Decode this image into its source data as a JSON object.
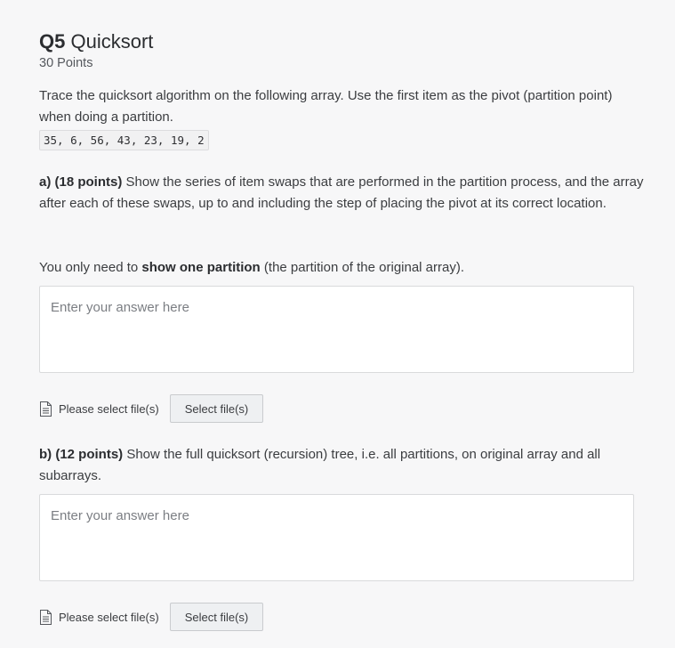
{
  "question": {
    "number": "Q5",
    "title": "Quicksort",
    "points": "30 Points",
    "intro": "Trace the quicksort algorithm on the following array. Use the first item as the pivot (partition point) when doing a partition.",
    "array": "35, 6, 56, 43, 23, 19, 2"
  },
  "part_a": {
    "label": "a) (18 points)",
    "text": " Show the series of item swaps that are performed in the partition process, and the array after each of these swaps, up to and including the step of placing the pivot at its correct location.",
    "note_prefix": "You only need to ",
    "note_bold": "show one partition",
    "note_suffix": " (the partition of the original array).",
    "answer_placeholder": "Enter your answer here",
    "file_label": "Please select file(s)",
    "file_button": "Select file(s)"
  },
  "part_b": {
    "label": "b) (12 points)",
    "text": " Show the full quicksort (recursion) tree, i.e. all partitions, on original array and all subarrays.",
    "answer_placeholder": "Enter your answer here",
    "file_label": "Please select file(s)",
    "file_button": "Select file(s)"
  },
  "icons": {
    "file": "file-icon"
  }
}
